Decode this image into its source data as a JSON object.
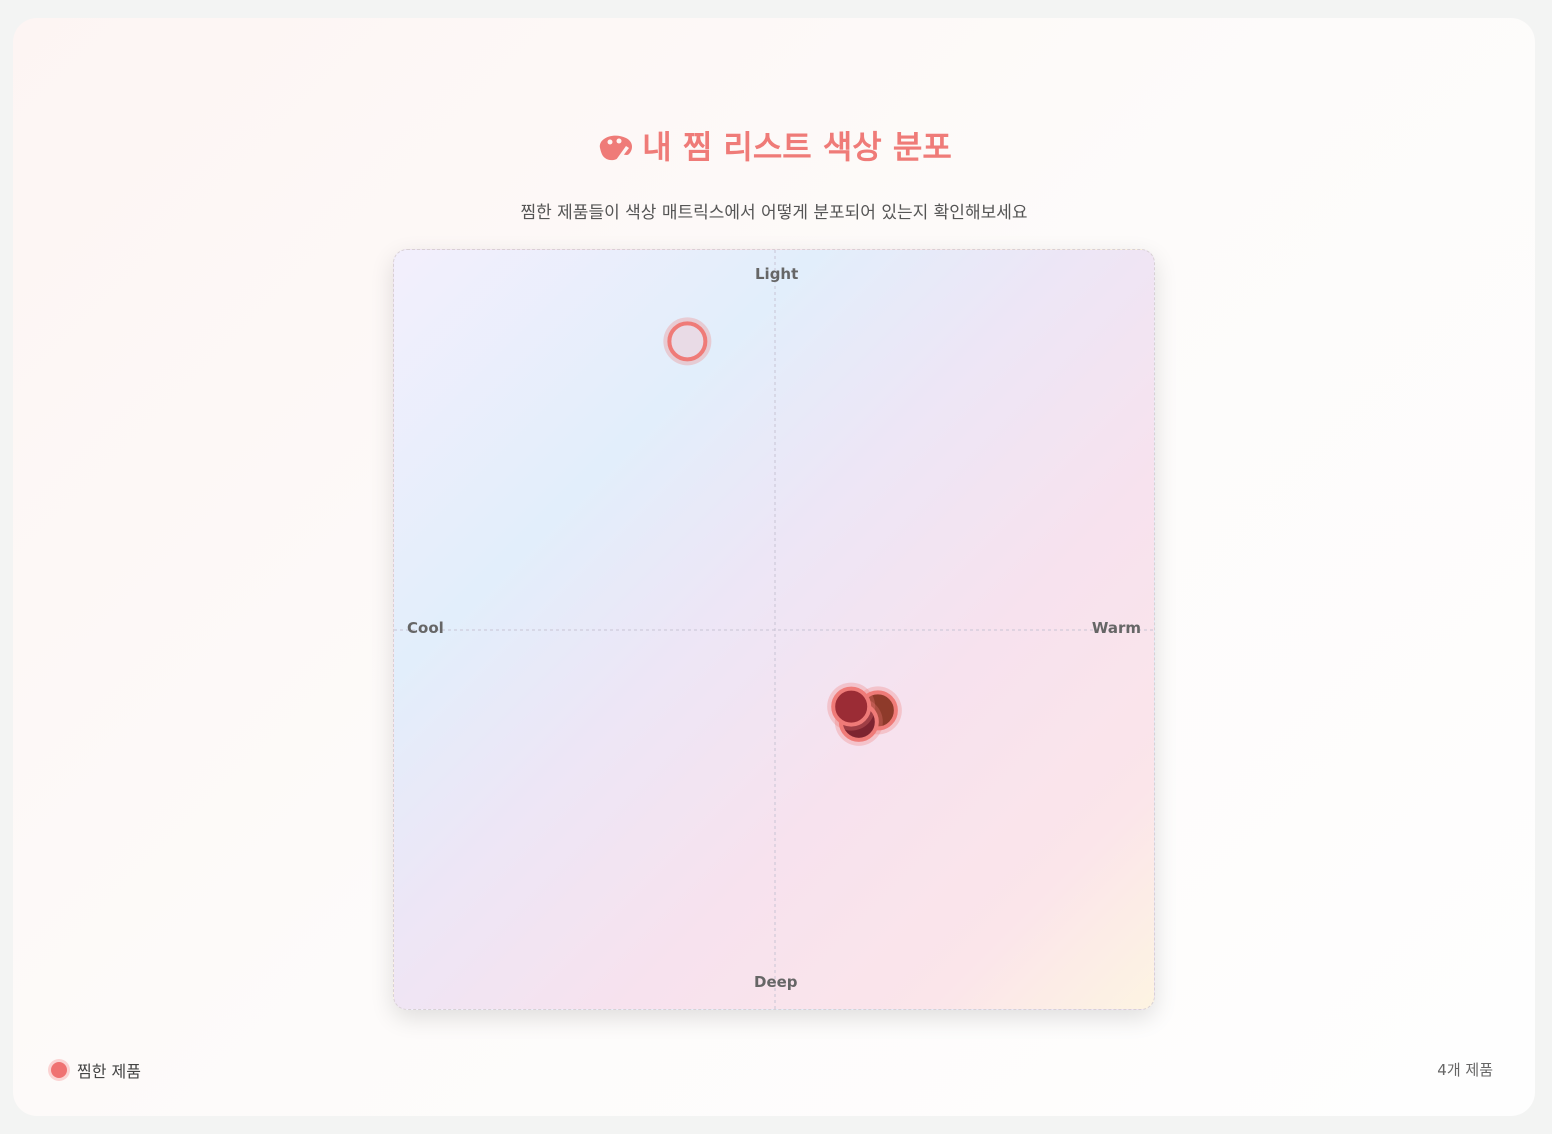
{
  "header": {
    "title": "내 찜 리스트 색상 분포",
    "title_icon": "palette-icon",
    "subtitle": "찜한 제품들이 색상 매트릭스에서 어떻게 분포되어 있는지 확인해보세요"
  },
  "chart_data": {
    "type": "scatter",
    "axis_labels": {
      "top": "Light",
      "bottom": "Deep",
      "left": "Cool",
      "right": "Warm"
    },
    "xlim": [
      -1,
      1
    ],
    "ylim": [
      -1,
      1
    ],
    "grid": "center crosshair dashed",
    "points": [
      {
        "x": -0.23,
        "y": 0.76,
        "color": "#e9dbe6"
      },
      {
        "x": 0.27,
        "y": -0.21,
        "color": "#8e3a2a"
      },
      {
        "x": 0.22,
        "y": -0.24,
        "color": "#7d2430"
      },
      {
        "x": 0.2,
        "y": -0.2,
        "color": "#9b2c35"
      }
    ],
    "marker_border": "#ef7b78"
  },
  "legend": {
    "label": "찜한 제품",
    "color": "#ef7272",
    "placement": "bottom-left"
  },
  "count_label": "4개 제품",
  "colors": {
    "accent": "#ef7b78"
  }
}
